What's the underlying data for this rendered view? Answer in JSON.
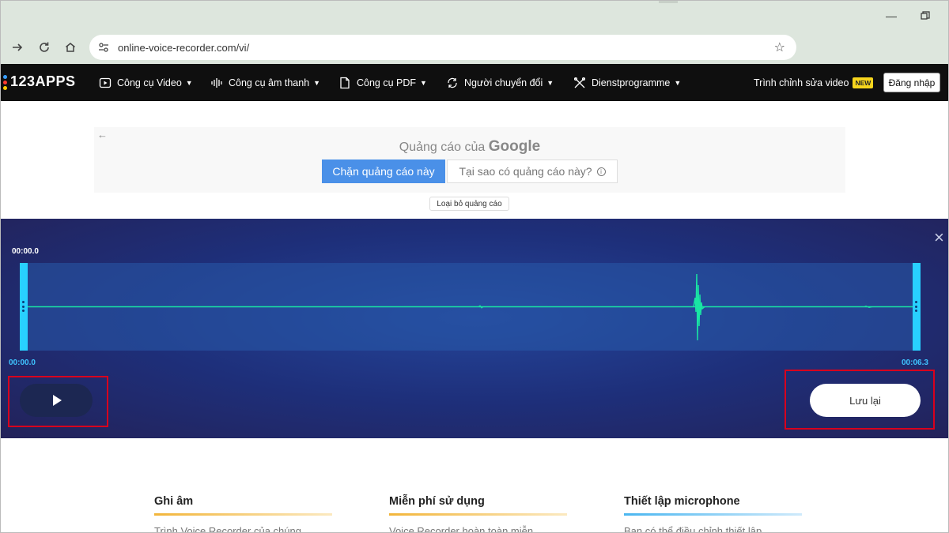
{
  "browser": {
    "url": "online-voice-recorder.com/vi/"
  },
  "appbar": {
    "logo": "123APPS",
    "menu": [
      {
        "label": "Công cụ Video",
        "icon": "video-icon"
      },
      {
        "label": "Công cụ âm thanh",
        "icon": "audio-wave-icon"
      },
      {
        "label": "Công cụ PDF",
        "icon": "pdf-file-icon"
      },
      {
        "label": "Người chuyển đổi",
        "icon": "convert-icon"
      },
      {
        "label": "Dienstprogramme",
        "icon": "tools-icon"
      }
    ],
    "editor_link": "Trình chỉnh sửa video",
    "new_badge": "NEW",
    "login": "Đăng nhập"
  },
  "ad": {
    "title_prefix": "Quảng cáo của",
    "title_brand": "Google",
    "block_button": "Chặn quảng cáo này",
    "why_button": "Tại sao có quảng cáo này?",
    "remove_ads": "Loại bỏ quảng cáo"
  },
  "recorder": {
    "time_cursor": "00:00.0",
    "time_start": "00:00.0",
    "time_end": "00:06.3",
    "duration_seconds": 6.3,
    "save_button": "Lưu lại"
  },
  "features": [
    {
      "title": "Ghi âm",
      "text": "Trình Voice Recorder của chúng"
    },
    {
      "title": "Miễn phí sử dụng",
      "text": "Voice Recorder hoàn toàn miễn"
    },
    {
      "title": "Thiết lập microphone",
      "text": "Bạn có thể điều chỉnh thiết lập"
    }
  ],
  "colors": {
    "highlight": "#d8001d",
    "accent": "#28d0ff",
    "wave": "#19e6a4",
    "ad_button": "#4a90e8",
    "new_badge": "#f7d51d"
  }
}
